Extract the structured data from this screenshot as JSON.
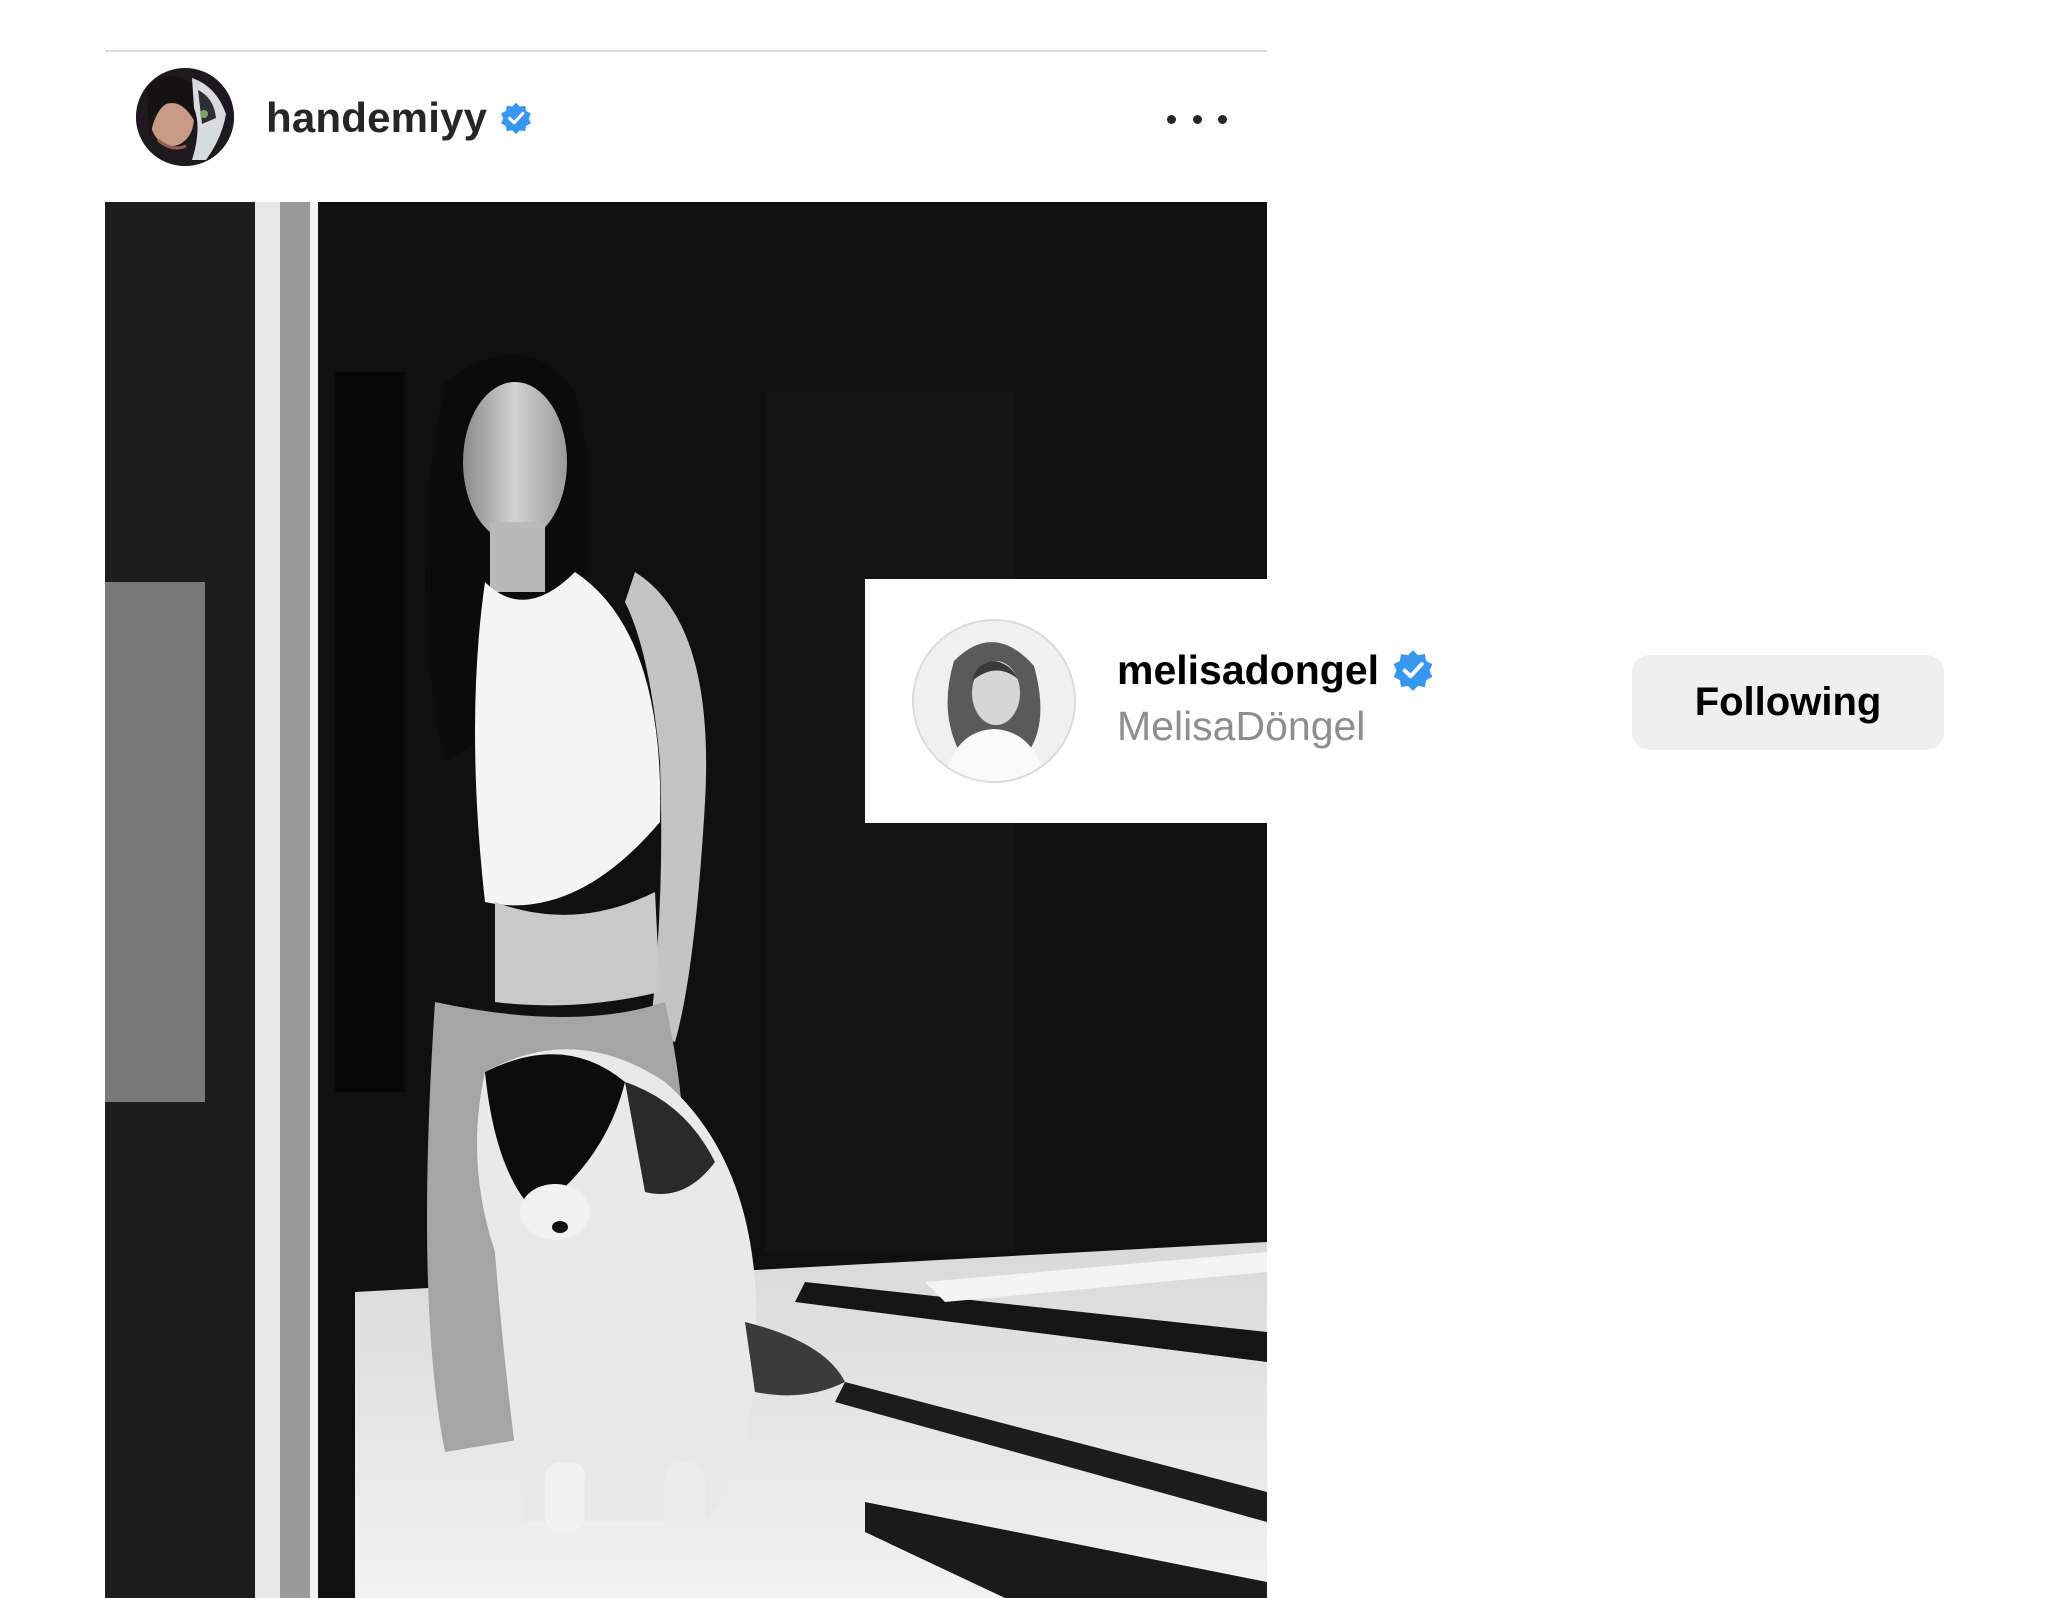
{
  "post": {
    "author": {
      "username": "handemiyy",
      "verified": true,
      "avatar_icon": "profile-avatar"
    },
    "more_icon": "more-horizontal-icon",
    "photo": {
      "description_icon": "photo"
    }
  },
  "suggested_account": {
    "username": "melisadongel",
    "full_name": "MelisaDöngel",
    "verified": true,
    "follow_button_label": "Following"
  },
  "colors": {
    "verified_blue": "#3897f0",
    "username_text": "#262626",
    "secondary_text": "#8e8e8e",
    "button_bg": "#efefef"
  }
}
